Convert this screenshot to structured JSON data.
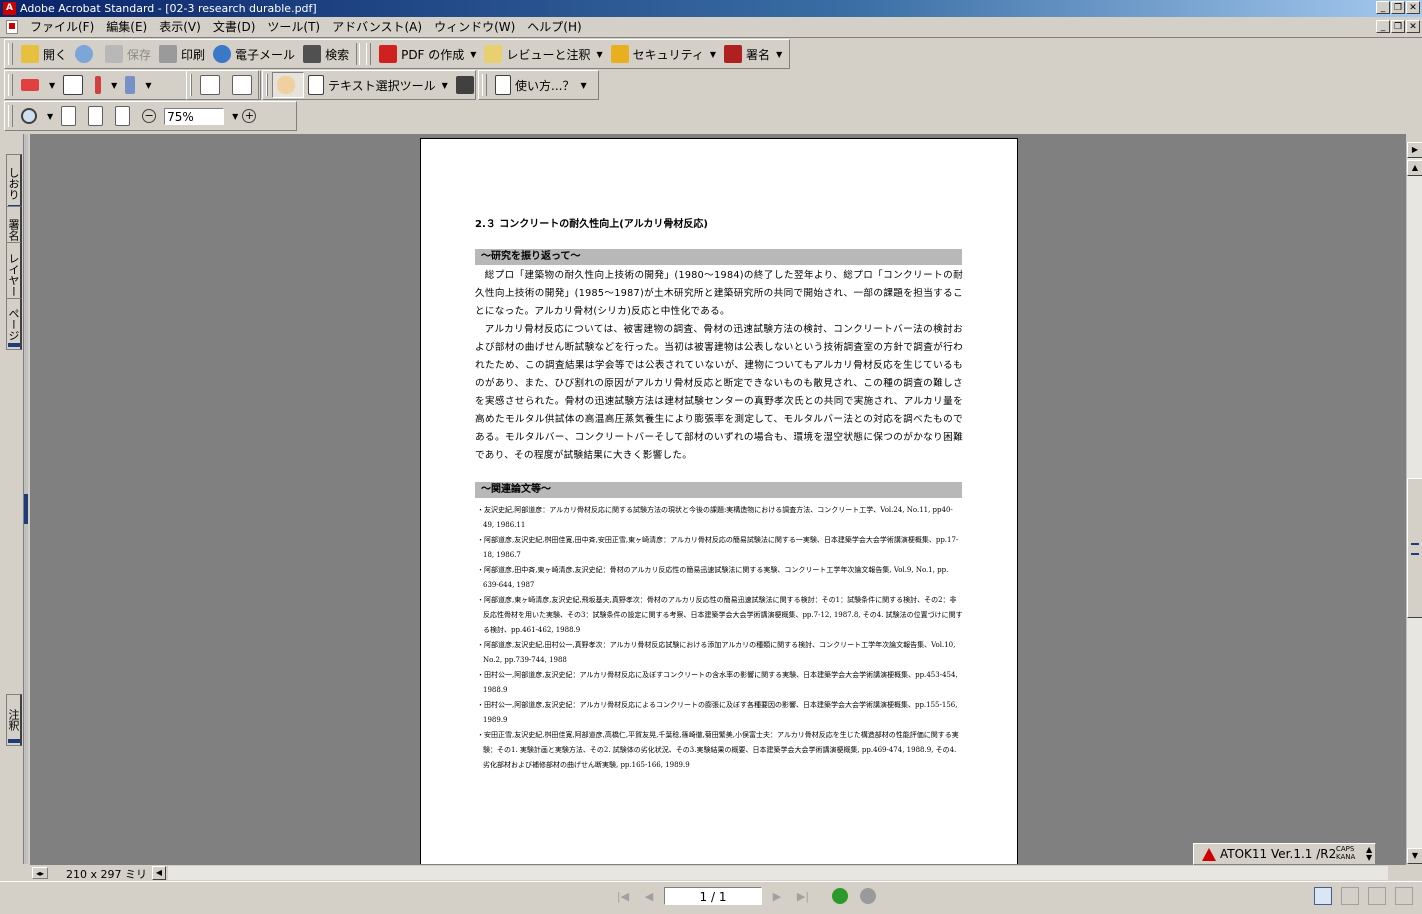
{
  "window": {
    "title": "Adobe Acrobat Standard - [02-3 research durable.pdf]",
    "controls": [
      "_",
      "❐",
      "✕"
    ]
  },
  "menu": {
    "items": [
      "ファイル(F)",
      "編集(E)",
      "表示(V)",
      "文書(D)",
      "ツール(T)",
      "アドバンスト(A)",
      "ウィンドウ(W)",
      "ヘルプ(H)"
    ],
    "controls": [
      "_",
      "❐",
      "✕"
    ]
  },
  "toolbar1": {
    "open": "開く",
    "save": "保存",
    "print": "印刷",
    "email": "電子メール",
    "search": "検索",
    "create_pdf": "PDF の作成",
    "review": "レビューと注釈",
    "security": "セキュリティ",
    "sign": "署名"
  },
  "toolbar2": {
    "text_select": "テキスト選択ツール",
    "howto": "使い方...？"
  },
  "toolbar3": {
    "zoom_value": "75%"
  },
  "nav_tabs": {
    "bookmarks": "しおり",
    "signatures": "署名",
    "layers": "レイヤー",
    "pages": "ページ",
    "comments": "注釈"
  },
  "document": {
    "section_title": "2.３ コンクリートの耐久性向上(アルカリ骨材反応)",
    "band1": "～研究を振り返って～",
    "paragraphs": [
      "総プロ「建築物の耐久性向上技術の開発」(1980～1984)の終了した翌年より、総プロ「コンクリートの耐久性向上技術の開発」(1985～1987)が土木研究所と建築研究所の共同で開始され、一部の課題を担当することになった。アルカリ骨材(シリカ)反応と中性化である。",
      "アルカリ骨材反応については、被害建物の調査、骨材の迅速試験方法の検討、コンクリートバー法の検討および部材の曲げせん断試験などを行った。当初は被害建物は公表しないという技術調査室の方針で調査が行われたため、この調査結果は学会等では公表されていないが、建物についてもアルカリ骨材反応を生じているものがあり、また、ひび割れの原因がアルカリ骨材反応と断定できないものも散見され、この種の調査の難しさを実感させられた。骨材の迅速試験方法は建材試験センターの真野孝次氏との共同で実施され、アルカリ量を高めたモルタル供試体の高温高圧蒸気養生により膨張率を測定して、モルタルバー法との対応を調べたものである。モルタルバー、コンクリートバーそして部材のいずれの場合も、環境を湿空状態に保つのがかなり困難であり、その程度が試験結果に大きく影響した。"
    ],
    "band2": "～関連論文等～",
    "references": [
      "・友沢史紀,阿部道彦：アルカリ骨材反応に関する試験方法の現状と今後の課題:実構造物における調査方法、コンクリート工学、Vol.24, No.11, pp40-49, 1986.11",
      "・阿部道彦,友沢史紀,桝田佳寛,田中斉,安田正雪,東ヶ崎清彦：アルカリ骨材反応の簡易試験法に関する一実験、日本建築学会大会学術講演梗概集、pp.17-18, 1986.7",
      "・阿部道彦,田中斉,東ヶ崎清彦,友沢史紀：骨材のアルカリ反応性の簡易迅速試験法に関する実験、コンクリート工学年次論文報告集, Vol.9, No.1, pp. 639-644, 1987",
      "・阿部道彦,東ヶ崎清彦,友沢史紀,飛坂基夫,真野孝次：骨材のアルカリ反応性の簡易迅速試験法に関する検討：その1：試験条件に関する検討、その2：非反応性骨材を用いた実験、その3：試験条件の設定に関する考察、日本建築学会大会学術講演梗概集、pp.7-12, 1987.8, その4. 試験法の位置づけに関する検討、pp.461-462, 1988.9",
      "・阿部道彦,友沢史紀,田村公一,真野孝次：アルカリ骨材反応試験における添加アルカリの種類に関する検討、コンクリート工学年次論文報告集、Vol.10, No.2, pp.739-744, 1988",
      "・田村公一,阿部道彦,友沢史紀：アルカリ骨材反応に及ぼすコンクリートの含水率の影響に関する実験、日本建築学会大会学術講演梗概集、pp.453-454, 1988.9",
      "・田村公一,阿部道彦,友沢史紀：アルカリ骨材反応によるコンクリートの膨張に及ぼす各種要因の影響、日本建築学会大会学術講演梗概集、pp.155-156, 1989.9",
      "・安田正雪,友沢史紀,桝田佳寛,阿部道彦,高橋仁,平賀友晃,千葉稔,篠崎徹,菊田繁美,小俣富士夫：アルカリ骨材反応を生じた構造部材の性能評価に関する実験：その1. 実験計画と実験方法、その2. 試験体の劣化状況、その3.実験結果の概要、日本建築学会大会学術講演梗概集, pp.469-474, 1988.9, その4. 劣化部材および補修部材の曲げせん断実験, pp.165-166, 1989.9"
    ]
  },
  "page_size": "210 x 297 ミリ",
  "status": {
    "page_indicator": "1 / 1"
  },
  "atok": {
    "label": "ATOK11 Ver.1.1 /R2",
    "caps": "CAPS",
    "kana": "KANA"
  }
}
